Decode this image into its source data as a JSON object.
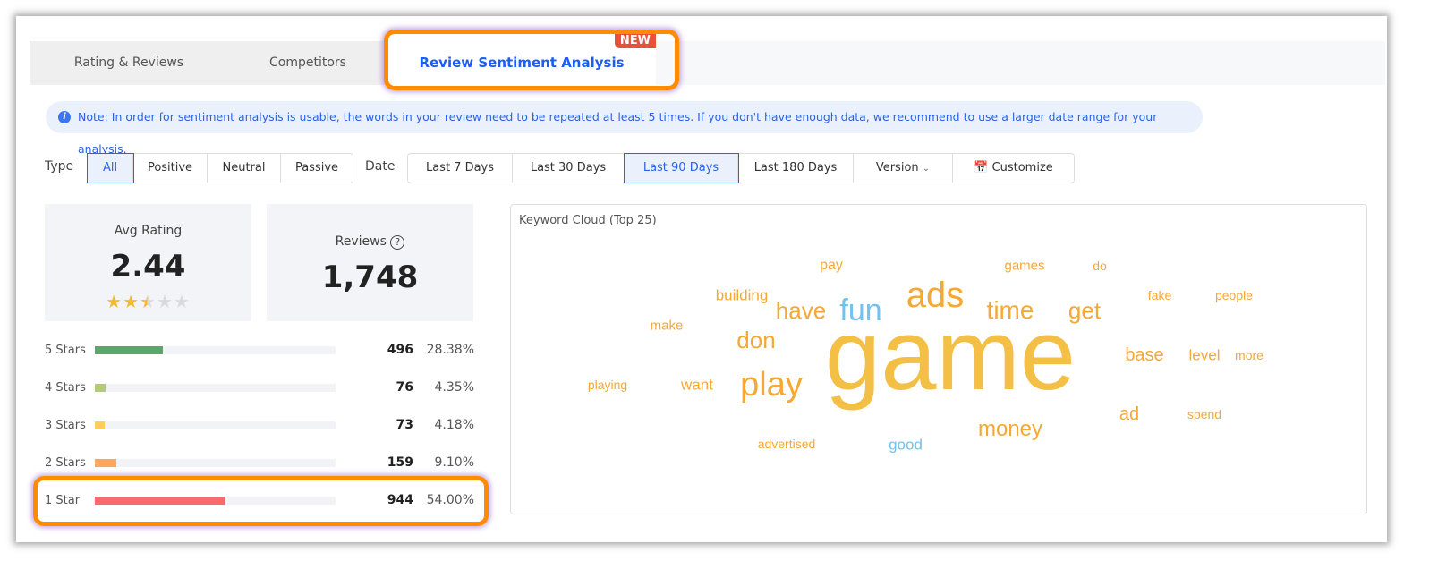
{
  "tabs": [
    {
      "label": "Rating & Reviews"
    },
    {
      "label": "Competitors"
    },
    {
      "label": "Review Sentiment Analysis",
      "badge": "NEW",
      "active": true
    }
  ],
  "note": {
    "icon": "info-icon",
    "text": "Note: In order for sentiment analysis is usable, the words in your review need to be repeated at least 5 times. If you don't have enough data, we recommend to use a larger date range for your analysis."
  },
  "filters": {
    "type_label": "Type",
    "types": [
      "All",
      "Positive",
      "Neutral",
      "Passive"
    ],
    "type_selected": "All",
    "date_label": "Date",
    "dates": [
      "Last 7 Days",
      "Last 30 Days",
      "Last 90 Days",
      "Last 180 Days",
      "Version",
      "Customize"
    ],
    "date_selected": "Last 90 Days"
  },
  "summary": {
    "avg_label": "Avg Rating",
    "avg_value": "2.44",
    "avg_stars": 2.44,
    "reviews_label": "Reviews",
    "reviews_value": "1,748"
  },
  "breakdown": [
    {
      "label": "5 Stars",
      "count": "496",
      "pct": "28.38%",
      "fraction": 0.2838,
      "color": "#58a86b"
    },
    {
      "label": "4 Stars",
      "count": "76",
      "pct": "4.35%",
      "fraction": 0.0435,
      "color": "#b3cc6e"
    },
    {
      "label": "3 Stars",
      "count": "73",
      "pct": "4.18%",
      "fraction": 0.0418,
      "color": "#fdcf5a"
    },
    {
      "label": "2 Stars",
      "count": "159",
      "pct": "9.10%",
      "fraction": 0.091,
      "color": "#fda660"
    },
    {
      "label": "1 Star",
      "count": "944",
      "pct": "54.00%",
      "fraction": 0.54,
      "color": "#f96a6a"
    }
  ],
  "cloud": {
    "title": "Keyword Cloud (Top 25)",
    "colors": {
      "orange": "#f5a834",
      "yellow": "#f4bf45",
      "blue": "#72c2ef"
    },
    "words": [
      "pay",
      "games",
      "do",
      "building",
      "ads",
      "fake",
      "people",
      "have",
      "fun",
      "time",
      "get",
      "make",
      "don",
      "game",
      "base",
      "level",
      "more",
      "playing",
      "want",
      "play",
      "ad",
      "spend",
      "money",
      "advertised",
      "good"
    ]
  }
}
